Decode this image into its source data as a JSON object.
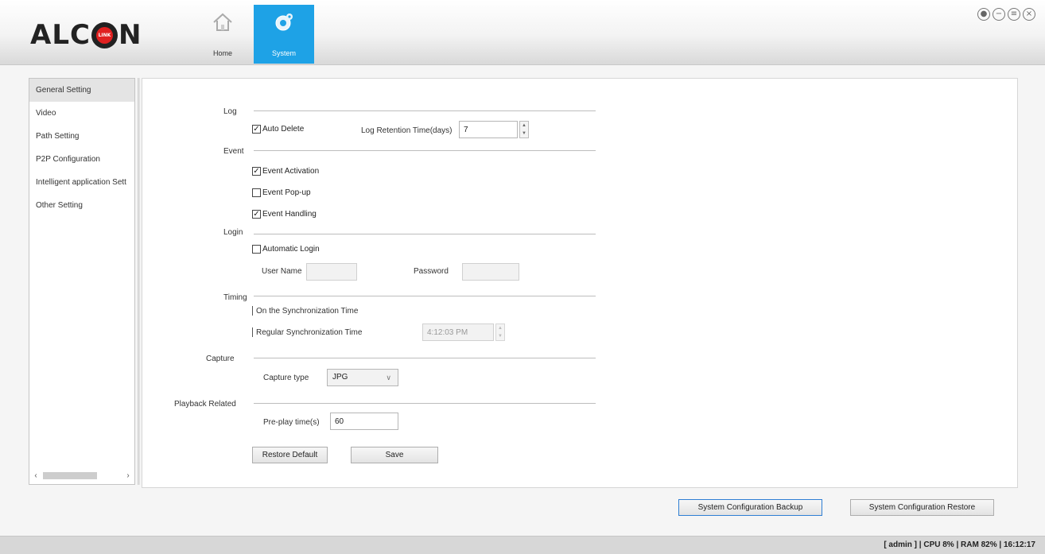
{
  "brand": {
    "logo_prefix": "ALC",
    "logo_badge": "LINK",
    "logo_suffix": "N"
  },
  "nav": {
    "tabs": [
      {
        "label": "Home",
        "icon": "home-icon",
        "active": false
      },
      {
        "label": "System",
        "icon": "gear-icon",
        "active": true
      }
    ],
    "accent_color": "#1ea2e6"
  },
  "window_controls": [
    "lock-icon",
    "minimize-icon",
    "restore-icon",
    "close-icon"
  ],
  "sidebar": {
    "items": [
      {
        "label": "General Setting",
        "active": true
      },
      {
        "label": "Video"
      },
      {
        "label": "Path Setting"
      },
      {
        "label": "P2P Configuration"
      },
      {
        "label": "Intelligent application Sett"
      },
      {
        "label": "Other Setting"
      }
    ],
    "scroll_left": "‹",
    "scroll_right": "›"
  },
  "log": {
    "title": "Log",
    "auto_delete_label": "Auto Delete",
    "auto_delete_checked": true,
    "retention_label": "Log Retention Time(days)",
    "retention_value": "7"
  },
  "event": {
    "title": "Event",
    "activation_label": "Event Activation",
    "activation_checked": true,
    "popup_label": "Event Pop-up",
    "popup_checked": false,
    "handling_label": "Event Handling",
    "handling_checked": true
  },
  "login": {
    "title": "Login",
    "auto_login_label": "Automatic Login",
    "auto_login_checked": false,
    "username_label": "User Name",
    "username_value": "",
    "password_label": "Password",
    "password_value": ""
  },
  "timing": {
    "title": "Timing",
    "on_sync_label": "On the Synchronization Time",
    "regular_sync_label": "Regular Synchronization Time",
    "regular_sync_value": "4:12:03 PM"
  },
  "capture": {
    "title": "Capture",
    "type_label": "Capture type",
    "type_value": "JPG"
  },
  "playback": {
    "title": "Playback Related",
    "preplay_label": "Pre-play time(s)",
    "preplay_value": "60"
  },
  "buttons": {
    "restore_default": "Restore Default",
    "save": "Save",
    "config_backup": "System Configuration Backup",
    "config_restore": "System Configuration Restore"
  },
  "status": {
    "text": "[ admin ] | CPU  8% | RAM  82% | 16:12:17"
  }
}
